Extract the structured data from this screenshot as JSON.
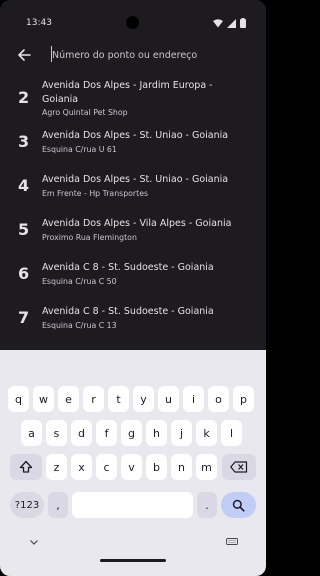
{
  "status": {
    "time": "13:43"
  },
  "search": {
    "placeholder": "Número do ponto ou endereço"
  },
  "results": [
    {
      "num": "2",
      "line1": "Avenida Dos Alpes - Jardim Europa -",
      "line2": "Goiania",
      "sub": "Agro Quintal Pet Shop"
    },
    {
      "num": "3",
      "line1": "Avenida Dos Alpes - St. Uniao - Goiania",
      "line2": "",
      "sub": "Esquina C/rua U 61"
    },
    {
      "num": "4",
      "line1": "Avenida Dos Alpes - St. Uniao - Goiania",
      "line2": "",
      "sub": "Em Frente - Hp Transportes"
    },
    {
      "num": "5",
      "line1": "Avenida Dos Alpes - Vila Alpes - Goiania",
      "line2": "",
      "sub": "Proximo Rua Flemington"
    },
    {
      "num": "6",
      "line1": "Avenida C 8 - St. Sudoeste - Goiania",
      "line2": "",
      "sub": "Esquina C/rua C 50"
    },
    {
      "num": "7",
      "line1": "Avenida C 8 - St. Sudoeste - Goiania",
      "line2": "",
      "sub": "Esquina C/rua C 13"
    }
  ],
  "keyboard": {
    "row1": [
      "q",
      "w",
      "e",
      "r",
      "t",
      "y",
      "u",
      "i",
      "o",
      "p"
    ],
    "row2": [
      "a",
      "s",
      "d",
      "f",
      "g",
      "h",
      "j",
      "k",
      "l"
    ],
    "row3": [
      "z",
      "x",
      "c",
      "v",
      "b",
      "n",
      "m"
    ],
    "symbols_label": "?123",
    "comma": ",",
    "period": "."
  },
  "icons": {
    "back": "arrow-left-icon",
    "shift": "shift-icon",
    "backspace": "backspace-icon",
    "search": "search-icon",
    "hide_keyboard": "chevron-down-icon",
    "keyboard_switch": "keyboard-icon",
    "wifi": "wifi-icon",
    "signal": "signal-icon",
    "battery": "battery-icon"
  },
  "colors": {
    "background": "#1d1b20",
    "text": "#e6e1e5",
    "subtext": "#cac4d0",
    "keyboard_bg": "#e9e8ee",
    "search_key": "#c2cdf7"
  }
}
